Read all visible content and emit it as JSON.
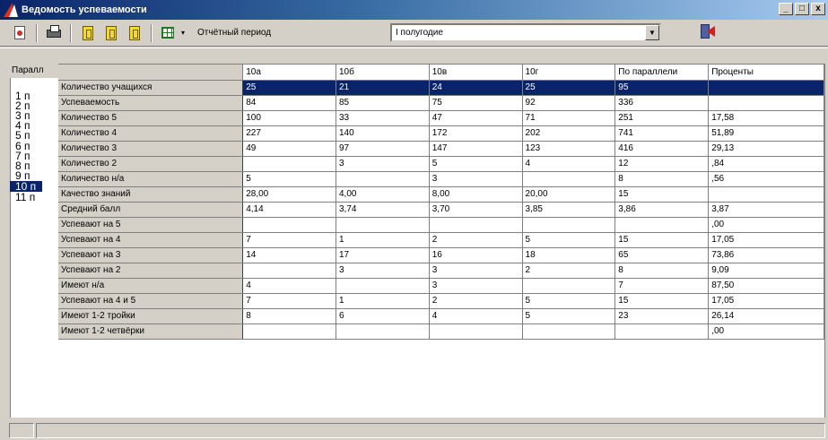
{
  "window": {
    "title": "Ведомость успеваемости",
    "controls": [
      "_",
      "□",
      "x"
    ]
  },
  "toolbar": {
    "period_label": "Отчётный период",
    "period_value": "I полугодие",
    "icons": [
      "document-icon",
      "printer-icon",
      "book-icon",
      "book-icon",
      "book-icon",
      "grid-icon",
      "exit-icon"
    ]
  },
  "parallels": {
    "header": "Паралл",
    "items": [
      "1 п",
      "2 п",
      "3 п",
      "4 п",
      "5 п",
      "6 п",
      "7 п",
      "8 п",
      "9 п",
      "10 п",
      "11 п"
    ],
    "selected": "10 п"
  },
  "table": {
    "columns": [
      "10а",
      "10б",
      "10в",
      "10г",
      "По параллели",
      "Проценты"
    ],
    "rows": [
      {
        "label": "Количество учащихся",
        "cells": [
          "25",
          "21",
          "24",
          "25",
          "95",
          ""
        ]
      },
      {
        "label": "Успеваемость",
        "cells": [
          "84",
          "85",
          "75",
          "92",
          "336",
          ""
        ]
      },
      {
        "label": "Количество 5",
        "cells": [
          "100",
          "33",
          "47",
          "71",
          "251",
          "17,58"
        ]
      },
      {
        "label": "Количество 4",
        "cells": [
          "227",
          "140",
          "172",
          "202",
          "741",
          "51,89"
        ]
      },
      {
        "label": "Количество 3",
        "cells": [
          "49",
          "97",
          "147",
          "123",
          "416",
          "29,13"
        ]
      },
      {
        "label": "Количество 2",
        "cells": [
          "",
          "3",
          "5",
          "4",
          "12",
          ",84"
        ]
      },
      {
        "label": "Количество н/а",
        "cells": [
          "5",
          "",
          "3",
          "",
          "8",
          ",56"
        ]
      },
      {
        "label": "Качество знаний",
        "cells": [
          "28,00",
          "4,00",
          "8,00",
          "20,00",
          "15",
          ""
        ]
      },
      {
        "label": "Средний балл",
        "cells": [
          "4,14",
          "3,74",
          "3,70",
          "3,85",
          "3,86",
          "3,87"
        ]
      },
      {
        "label": "Успевают на 5",
        "cells": [
          "",
          "",
          "",
          "",
          "",
          ",00"
        ]
      },
      {
        "label": "Успевают на 4",
        "cells": [
          "7",
          "1",
          "2",
          "5",
          "15",
          "17,05"
        ]
      },
      {
        "label": "Успевают на 3",
        "cells": [
          "14",
          "17",
          "16",
          "18",
          "65",
          "73,86"
        ]
      },
      {
        "label": "Успевают на 2",
        "cells": [
          "",
          "3",
          "3",
          "2",
          "8",
          "9,09"
        ]
      },
      {
        "label": "Имеют н/а",
        "cells": [
          "4",
          "",
          "3",
          "",
          "7",
          "87,50"
        ]
      },
      {
        "label": "Успевают на 4 и 5",
        "cells": [
          "7",
          "1",
          "2",
          "5",
          "15",
          "17,05"
        ]
      },
      {
        "label": "Имеют 1-2 тройки",
        "cells": [
          "8",
          "6",
          "4",
          "5",
          "23",
          "26,14"
        ]
      },
      {
        "label": "Имеют 1-2 четвёрки",
        "cells": [
          "",
          "",
          "",
          "",
          "",
          ",00"
        ]
      }
    ],
    "selected_row": 0
  },
  "colors": {
    "title_gradient_start": "#0a246a",
    "title_gradient_end": "#a6caf0",
    "selection": "#0a246a",
    "face": "#d4d0c8"
  }
}
